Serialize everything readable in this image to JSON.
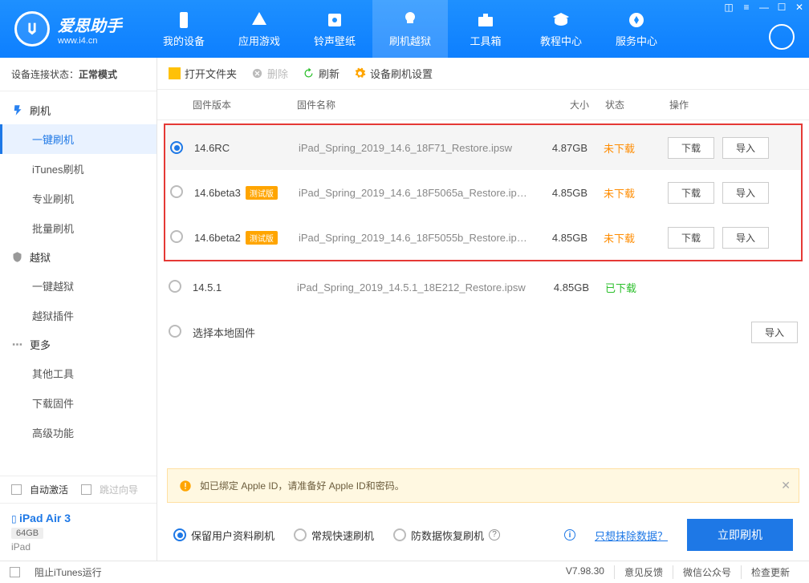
{
  "brand": {
    "title": "爱思助手",
    "sub": "www.i4.cn"
  },
  "nav": [
    "我的设备",
    "应用游戏",
    "铃声壁纸",
    "刷机越狱",
    "工具箱",
    "教程中心",
    "服务中心"
  ],
  "status": {
    "label": "设备连接状态：",
    "value": "正常模式"
  },
  "menu": {
    "flash": {
      "header": "刷机",
      "items": [
        "一键刷机",
        "iTunes刷机",
        "专业刷机",
        "批量刷机"
      ]
    },
    "jb": {
      "header": "越狱",
      "items": [
        "一键越狱",
        "越狱插件"
      ]
    },
    "more": {
      "header": "更多",
      "items": [
        "其他工具",
        "下载固件",
        "高级功能"
      ]
    }
  },
  "sidebottom": {
    "auto": "自动激活",
    "skip": "跳过向导"
  },
  "device": {
    "name": "iPad Air 3",
    "storage": "64GB",
    "type": "iPad"
  },
  "toolbar": {
    "open": "打开文件夹",
    "del": "删除",
    "refresh": "刷新",
    "settings": "设备刷机设置"
  },
  "columns": {
    "ver": "固件版本",
    "name": "固件名称",
    "size": "大小",
    "status": "状态",
    "act": "操作"
  },
  "betaLabel": "测试版",
  "rows": [
    {
      "ver": "14.6RC",
      "beta": false,
      "name": "iPad_Spring_2019_14.6_18F71_Restore.ipsw",
      "size": "4.87GB",
      "status": "未下载",
      "st": "n",
      "checked": true
    },
    {
      "ver": "14.6beta3",
      "beta": true,
      "name": "iPad_Spring_2019_14.6_18F5065a_Restore.ip…",
      "size": "4.85GB",
      "status": "未下载",
      "st": "n",
      "checked": false
    },
    {
      "ver": "14.6beta2",
      "beta": true,
      "name": "iPad_Spring_2019_14.6_18F5055b_Restore.ip…",
      "size": "4.85GB",
      "status": "未下载",
      "st": "n",
      "checked": false
    }
  ],
  "outrow": {
    "ver": "14.5.1",
    "name": "iPad_Spring_2019_14.5.1_18E212_Restore.ipsw",
    "size": "4.85GB",
    "status": "已下载"
  },
  "localrow": {
    "label": "选择本地固件"
  },
  "btns": {
    "download": "下载",
    "import": "导入"
  },
  "alert": "如已绑定 Apple ID，请准备好 Apple ID和密码。",
  "opts": {
    "a": "保留用户资料刷机",
    "b": "常规快速刷机",
    "c": "防数据恢复刷机",
    "link": "只想抹除数据？",
    "go": "立即刷机"
  },
  "footer": {
    "block": "阻止iTunes运行",
    "ver": "V7.98.30",
    "fb": "意见反馈",
    "wx": "微信公众号",
    "upd": "检查更新"
  }
}
